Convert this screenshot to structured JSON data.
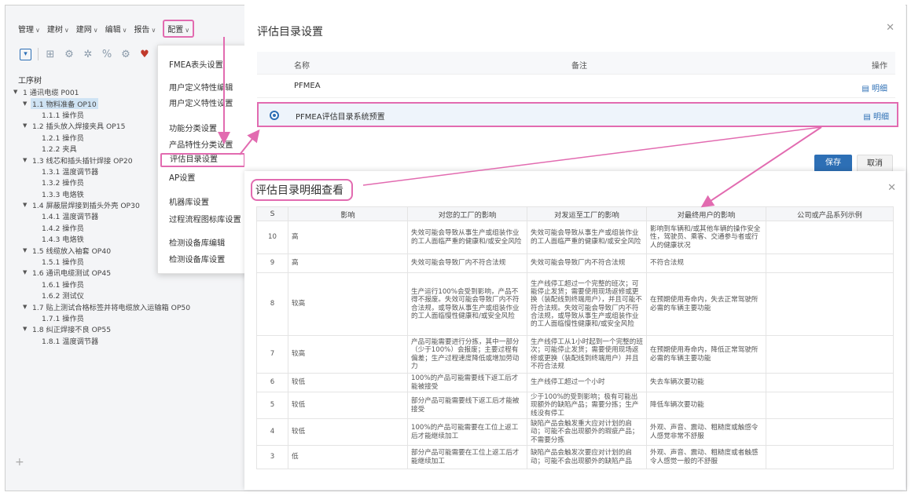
{
  "menubar": {
    "items": [
      "管理",
      "建树",
      "建网",
      "编辑",
      "报告",
      "配置"
    ]
  },
  "tree": {
    "title": "工序树",
    "rows": [
      {
        "label": "1 通讯电缆 P001",
        "level": 0,
        "toggle": "▼"
      },
      {
        "label": "1.1 物料准备 OP10",
        "level": 1,
        "toggle": "▼",
        "selected": true
      },
      {
        "label": "1.1.1 操作员",
        "level": 2,
        "toggle": ""
      },
      {
        "label": "1.2 插头放入焊接夹具 OP15",
        "level": 1,
        "toggle": "▼"
      },
      {
        "label": "1.2.1 操作员",
        "level": 2,
        "toggle": ""
      },
      {
        "label": "1.2.2 夹具",
        "level": 2,
        "toggle": ""
      },
      {
        "label": "1.3 线芯和插头插针焊接 OP20",
        "level": 1,
        "toggle": "▼"
      },
      {
        "label": "1.3.1 温度调节器",
        "level": 2,
        "toggle": ""
      },
      {
        "label": "1.3.2 操作员",
        "level": 2,
        "toggle": ""
      },
      {
        "label": "1.3.3 电烙铁",
        "level": 2,
        "toggle": ""
      },
      {
        "label": "1.4 屏蔽层焊接到插头外壳 OP30",
        "level": 1,
        "toggle": "▼"
      },
      {
        "label": "1.4.1 温度调节器",
        "level": 2,
        "toggle": ""
      },
      {
        "label": "1.4.2 操作员",
        "level": 2,
        "toggle": ""
      },
      {
        "label": "1.4.3 电烙铁",
        "level": 2,
        "toggle": ""
      },
      {
        "label": "1.5 线缆放入袖套 OP40",
        "level": 1,
        "toggle": "▼"
      },
      {
        "label": "1.5.1 操作员",
        "level": 2,
        "toggle": ""
      },
      {
        "label": "1.6 通讯电缆测试 OP45",
        "level": 1,
        "toggle": "▼"
      },
      {
        "label": "1.6.1 操作员",
        "level": 2,
        "toggle": ""
      },
      {
        "label": "1.6.2 测试仪",
        "level": 2,
        "toggle": ""
      },
      {
        "label": "1.7 贴上测试合格标签并将电缆放入运输箱 OP50",
        "level": 1,
        "toggle": "▼"
      },
      {
        "label": "1.7.1 操作员",
        "level": 2,
        "toggle": ""
      },
      {
        "label": "1.8 纠正焊接不良 OP55",
        "level": 1,
        "toggle": "▼"
      },
      {
        "label": "1.8.1 温度调节器",
        "level": 2,
        "toggle": ""
      }
    ]
  },
  "dropdown": {
    "items": [
      "FMEA表头设置",
      "用户定义特性编辑",
      "用户定义特性设置",
      "功能分类设置",
      "产品特性分类设置",
      "评估目录设置",
      "AP设置",
      "机器库设置",
      "过程流程图标库设置",
      "检测设备库编辑",
      "检测设备库设置"
    ]
  },
  "settings": {
    "title": "评估目录设置",
    "col_name": "名称",
    "col_remark": "备注",
    "col_action": "操作",
    "rows": [
      {
        "name": "PFMEA",
        "action": "明细"
      },
      {
        "name": "PFMEA评估目录系统预置",
        "action": "明细"
      }
    ],
    "save": "保存",
    "cancel": "取消"
  },
  "detail": {
    "title": "评估目录明细查看",
    "headers": [
      "S",
      "影响",
      "对您的工厂的影响",
      "对发运至工厂的影响",
      "对最终用户的影响",
      "公司或产品系列示例"
    ],
    "rows": [
      {
        "s": "10",
        "impact": "高",
        "plant": "失效可能会导致从事生产或组装作业的工人面临严重的健康和/或安全风险",
        "ship": "失效可能会导致从事生产或组装作业的工人面临严重的健康和/或安全风险",
        "user": "影响到车辆和/或其他车辆的操作安全性，驾驶员、乘客、交通参与者或行人的健康状况",
        "example": ""
      },
      {
        "s": "9",
        "impact": "高",
        "plant": "失效可能会导致厂内不符合法规",
        "ship": "失效可能会导致厂内不符合法规",
        "user": "不符合法规",
        "example": ""
      },
      {
        "s": "8",
        "impact": "较高",
        "plant": "生产运行100%会受到影响，产品不得不报废。失效可能会导致厂内不符合法规，或导致从事生产或组装作业的工人面临慢性健康和/或安全风险",
        "ship": "生产线停工超过一个完整的班次；可能停止发货；需要使用现场返修或更换（装配线到终端用户），并且可能不符合法规。失效可能会导致厂内不符合法规，或导致从事生产或组装作业的工人面临慢性健康和/或安全风险",
        "user": "在预期使用寿命内，失去正常驾驶所必需的车辆主要功能",
        "example": ""
      },
      {
        "s": "7",
        "impact": "较高",
        "plant": "产品可能需要进行分拣，其中一部分（少于100%）会报废；主要过程有偏差；生产过程速度降低或增加劳动力",
        "ship": "生产线停工从1小时起到一个完整的班次；可能停止发货；需要使用现场返修或更换（装配线到终端用户）并且不符合法规",
        "user": "在预期使用寿命内，降低正常驾驶所必需的车辆主要功能",
        "example": ""
      },
      {
        "s": "6",
        "impact": "较低",
        "plant": "100%的产品可能需要线下返工后才能被接受",
        "ship": "生产线停工超过一个小时",
        "user": "失去车辆次要功能",
        "example": ""
      },
      {
        "s": "5",
        "impact": "较低",
        "plant": "部分产品可能需要线下返工后才能被接受",
        "ship": "少于100%的受到影响；极有可能出现额外的缺陷产品；需要分拣；生产线没有停工",
        "user": "降低车辆次要功能",
        "example": ""
      },
      {
        "s": "4",
        "impact": "较低",
        "plant": "100%的产品可能需要在工位上返工后才能继续加工",
        "ship": "缺陷产品会触发重大应对计划的启动；可能不会出现额外的瑕疵产品；不需要分拣",
        "user": "外观、声音、震动、粗糙度或触感令人感觉非常不舒服",
        "example": ""
      },
      {
        "s": "3",
        "impact": "低",
        "plant": "部分产品可能需要在工位上返工后才能继续加工",
        "ship": "缺陷产品会触发次要应对计划的启动；可能不会出现额外的缺陷产品",
        "user": "外观、声音、震动、粗糙度或者触感令人感觉一般的不舒服",
        "example": ""
      }
    ]
  },
  "colors": {
    "highlight": "#e26bb0",
    "primary": "#2d6fb5"
  }
}
